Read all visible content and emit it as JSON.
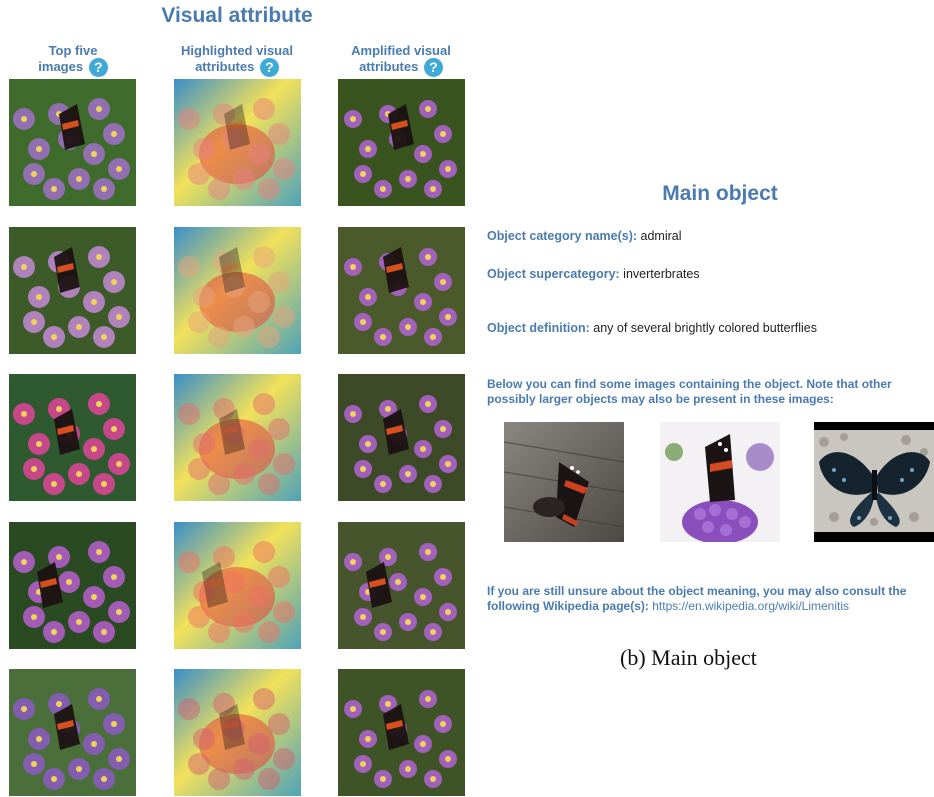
{
  "visual": {
    "title": "Visual attribute",
    "columns": [
      {
        "line1": "Top five",
        "line2": "images"
      },
      {
        "line1": "Highlighted visual",
        "line2": "attributes"
      },
      {
        "line1": "Amplified visual",
        "line2": "attributes"
      }
    ],
    "help_glyph": "?",
    "rows": 5
  },
  "main": {
    "title": "Main object",
    "category_label": "Object category name(s):",
    "category_value": "admiral",
    "supercategory_label": "Object supercategory:",
    "supercategory_value": "inverterbrates",
    "definition_label": "Object definition:",
    "definition_value": "any of several brightly colored butterflies",
    "images_intro": "Below you can find some images containing the object. Note that other possibly larger objects may also be present in these images:",
    "wiki_intro": "If you are still unsure about the object meaning, you may also consult the following Wikipedia page(s):",
    "wiki_link": "https://en.wikipedia.org/wiki/Limenitis"
  },
  "caption": "(b) Main object",
  "colors": {
    "accent": "#4a7bb0",
    "help": "#3fa9d8"
  },
  "icons": {
    "help": "question-mark-circle-icon"
  }
}
